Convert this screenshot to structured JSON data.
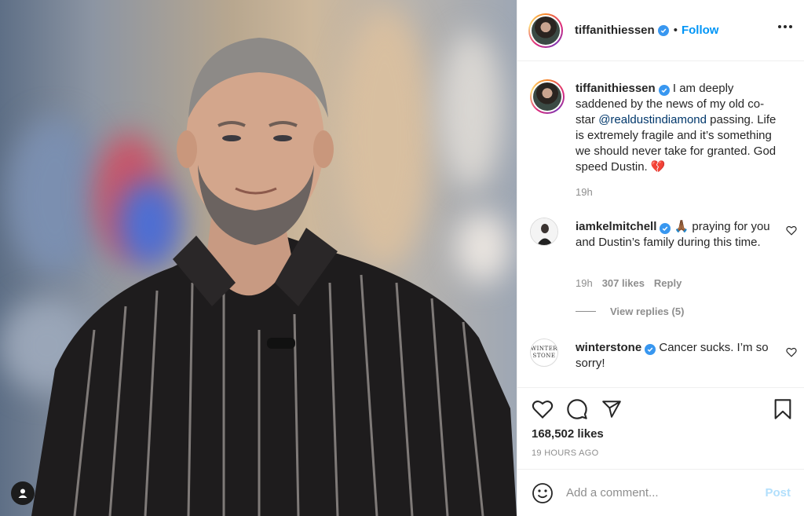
{
  "post": {
    "author": "tiffanithiessen",
    "follow_label": "Follow",
    "dot": "•",
    "caption": "I am deeply saddened by the news of my old co-star",
    "caption_mention": "@realdustindiamond",
    "caption_rest": "passing. Life is extremely fragile and it’s something we should never take for granted. God speed Dustin.",
    "caption_emoji": "💔",
    "caption_age": "19h",
    "likes": "168,502 likes",
    "timestamp": "19 HOURS AGO"
  },
  "comments": [
    {
      "author": "iamkelmitchell",
      "emoji": "🙏🏾",
      "text": "praying for you and Dustin’s family during this time.",
      "age": "19h",
      "likes": "307 likes",
      "reply_label": "Reply",
      "view_replies": "View replies (5)"
    },
    {
      "author": "winterstone",
      "avatar_text_1": "WINTER",
      "avatar_text_2": "STONE",
      "text": "Cancer sucks. I’m so sorry!"
    }
  ],
  "add_comment": {
    "placeholder": "Add a comment...",
    "post_label": "Post"
  },
  "colors": {
    "link": "#0095f6",
    "verified": "#3897f0",
    "muted": "#8e8e8e",
    "post_disabled": "#b2dffc"
  },
  "icons": [
    "verified-icon",
    "more-icon",
    "heart-icon",
    "comment-icon",
    "share-icon",
    "bookmark-icon",
    "emoji-icon",
    "user-tag-icon"
  ]
}
